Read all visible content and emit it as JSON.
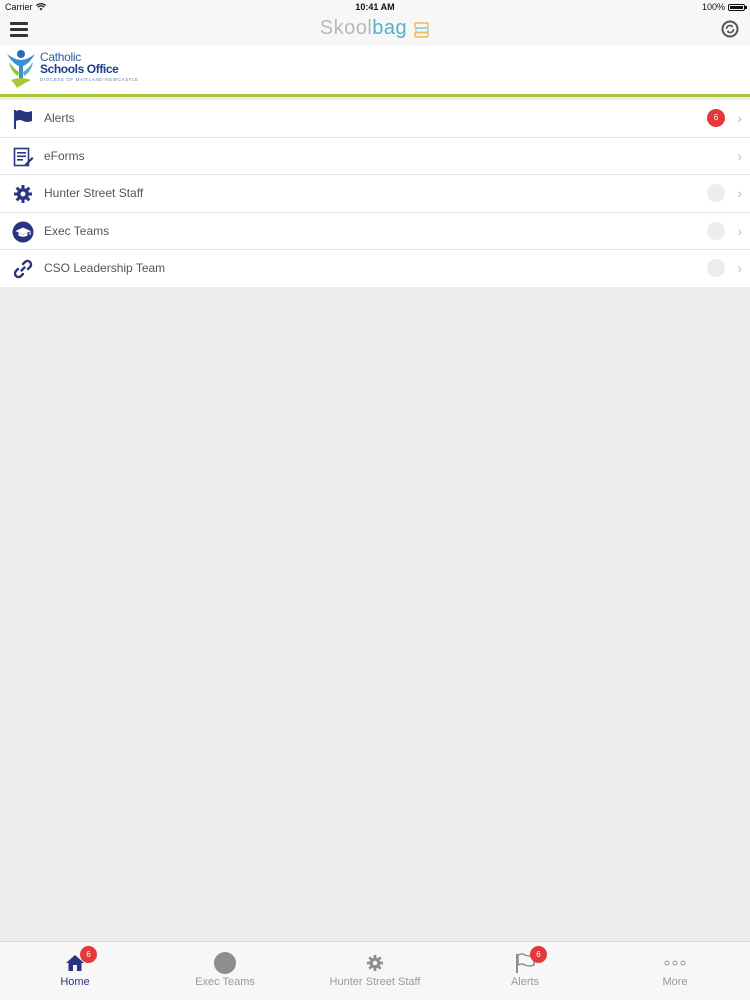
{
  "status": {
    "carrier": "Carrier",
    "time": "10:41 AM",
    "battery": "100%",
    "battery_level": 1.0
  },
  "nav": {
    "title_part1": "Skool",
    "title_part2": "bag"
  },
  "logo": {
    "line1": "Catholic",
    "line2": "Schools Office",
    "line3": "DIOCESE OF MAITLAND-NEWCASTLE"
  },
  "list": {
    "items": [
      {
        "label": "Alerts",
        "icon": "flag-icon",
        "badge": "6"
      },
      {
        "label": "eForms",
        "icon": "form-icon"
      },
      {
        "label": "Hunter Street Staff",
        "icon": "gear-icon"
      },
      {
        "label": "Exec Teams",
        "icon": "graduation-cap-icon"
      },
      {
        "label": "CSO Leadership Team",
        "icon": "link-icon"
      }
    ]
  },
  "tabs": [
    {
      "label": "Home",
      "icon": "home-icon",
      "badge": "6",
      "active": true
    },
    {
      "label": "Exec Teams",
      "icon": "circle-icon"
    },
    {
      "label": "Hunter Street Staff",
      "icon": "gear-icon"
    },
    {
      "label": "Alerts",
      "icon": "flag-icon",
      "badge": "6"
    },
    {
      "label": "More",
      "icon": "more-dots-icon"
    }
  ],
  "colors": {
    "accent_green": "#a8c83a",
    "icon_navy": "#2a3580",
    "badge_red": "#e5383b",
    "title_teal": "#4fb3c9"
  }
}
